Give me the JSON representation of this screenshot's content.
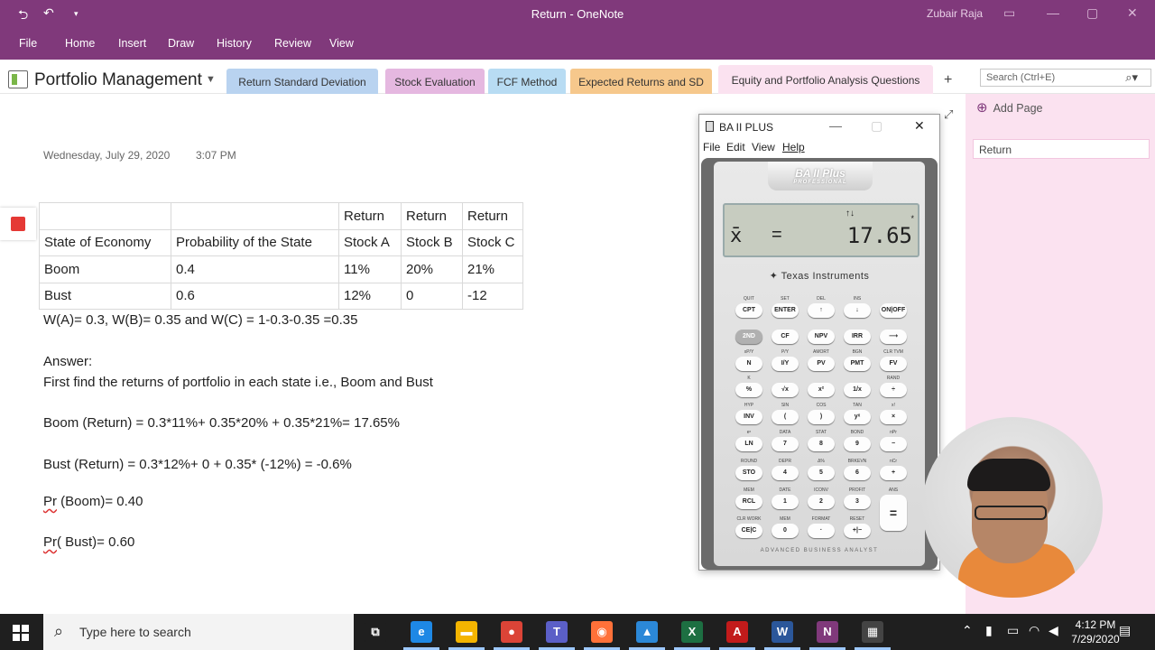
{
  "window": {
    "title": "Return - OneNote",
    "user": "Zubair Raja",
    "back_icon": "back-arrow-icon",
    "undo_icon": "undo-icon",
    "qat_icon": "customize-qat-icon"
  },
  "ribbon": {
    "menus": [
      "File",
      "Home",
      "Insert",
      "Draw",
      "History",
      "Review",
      "View"
    ]
  },
  "notebook": {
    "title": "Portfolio Management",
    "sections": [
      {
        "label": "Return Standard Deviation",
        "color": "#b9d3f0"
      },
      {
        "label": "Stock Evaluation",
        "color": "#e5b8e0"
      },
      {
        "label": "FCF Method",
        "color": "#b8dcf3"
      },
      {
        "label": "Expected Returns and SD",
        "color": "#f6c88c"
      },
      {
        "label": "Equity and Portfolio Analysis Questions",
        "color": "#fbe2f0"
      }
    ],
    "search_placeholder": "Search (Ctrl+E)"
  },
  "page": {
    "date": "Wednesday, July 29, 2020",
    "time": "3:07 PM",
    "table": [
      [
        "",
        "",
        "Return",
        "Return",
        "Return"
      ],
      [
        "State of Economy",
        "Probability of the State",
        "Stock A",
        "Stock B",
        "Stock C"
      ],
      [
        "Boom",
        "0.4",
        "11%",
        "20%",
        "21%"
      ],
      [
        "Bust",
        "0.6",
        "12%",
        "0",
        "-12"
      ]
    ],
    "weights": "W(A)= 0.3, W(B)= 0.35 and W(C) = 1-0.3-0.35 =0.35",
    "answer_label": "Answer:",
    "instruction": "First find the returns of portfolio in each state i.e., Boom and Bust",
    "boom_return": "Boom (Return) = 0.3*11%+ 0.35*20% + 0.35*21%= 17.65%",
    "bust_return": "Bust (Return) =  0.3*12%+ 0 + 0.35* (-12%) = -0.6%",
    "pr_boom_word": "Pr",
    "pr_boom_rest": " (Boom)= 0.40",
    "pr_bust_word": "Pr",
    "pr_bust_rest": "( Bust)= 0.60"
  },
  "pagelist": {
    "add_page": "Add Page",
    "pages": [
      "Return"
    ]
  },
  "calculator": {
    "title": "BA II PLUS",
    "menus": [
      "File",
      "Edit",
      "View",
      "Help"
    ],
    "brand": "BA II Plus",
    "brand_sub": "PROFESSIONAL",
    "display_symbol": "x̄",
    "display_eq": "=",
    "display_value": "17.65",
    "display_arrows": "↑↓",
    "display_star": "*",
    "maker": "Texas Instruments",
    "footer": "ADVANCED BUSINESS ANALYST",
    "keys": [
      [
        "CPT",
        "ENTER",
        "↑",
        "↓",
        "ON|OFF"
      ],
      [
        "2ND",
        "CF",
        "NPV",
        "IRR",
        "⟶"
      ],
      [
        "N",
        "I/Y",
        "PV",
        "PMT",
        "FV"
      ],
      [
        "%",
        "√x",
        "x²",
        "1/x",
        "÷"
      ],
      [
        "INV",
        "(",
        ")",
        "yˣ",
        "×"
      ],
      [
        "LN",
        "7",
        "8",
        "9",
        "−"
      ],
      [
        "STO",
        "4",
        "5",
        "6",
        "+"
      ],
      [
        "RCL",
        "1",
        "2",
        "3",
        "="
      ],
      [
        "CE|C",
        "0",
        "·",
        "+|−",
        ""
      ]
    ],
    "sublabels": [
      [
        "QUIT",
        "SET",
        "DEL",
        "INS",
        ""
      ],
      [
        "",
        "",
        "",
        "",
        ""
      ],
      [
        "xP/Y",
        "P/Y",
        "AMORT",
        "BGN",
        "CLR TVM"
      ],
      [
        "K",
        "",
        "",
        "",
        "RAND"
      ],
      [
        "HYP",
        "SIN",
        "COS",
        "TAN",
        "x!"
      ],
      [
        "eˣ",
        "DATA",
        "STAT",
        "BOND",
        "nPr"
      ],
      [
        "ROUND",
        "DEPR",
        "Δ%",
        "BRKEVN",
        "nCr"
      ],
      [
        "MEM",
        "DATE",
        "ICONV",
        "PROFIT",
        "ANS"
      ],
      [
        "CLR WORK",
        "MEM",
        "FORMAT",
        "RESET",
        ""
      ]
    ]
  },
  "taskbar": {
    "search_placeholder": "Type here to search",
    "time": "4:12 PM",
    "date": "7/29/2020",
    "apps": [
      {
        "icon": "task-view-icon",
        "color": "#1f1f1f",
        "glyph": "⧉"
      },
      {
        "icon": "edge-icon",
        "color": "#1e88e5",
        "glyph": "e"
      },
      {
        "icon": "file-explorer-icon",
        "color": "#f4b400",
        "glyph": "▬"
      },
      {
        "icon": "chrome-icon",
        "color": "#db4437",
        "glyph": "●"
      },
      {
        "icon": "teams-icon",
        "color": "#5b5fc7",
        "glyph": "T"
      },
      {
        "icon": "firefox-icon",
        "color": "#ff7139",
        "glyph": "◉"
      },
      {
        "icon": "photos-icon",
        "color": "#2b88d8",
        "glyph": "▲"
      },
      {
        "icon": "excel-icon",
        "color": "#1d6f42",
        "glyph": "X"
      },
      {
        "icon": "acrobat-icon",
        "color": "#c21b1b",
        "glyph": "A"
      },
      {
        "icon": "word-icon",
        "color": "#2b579a",
        "glyph": "W"
      },
      {
        "icon": "onenote-icon",
        "color": "#80397b",
        "glyph": "N"
      },
      {
        "icon": "calculator-icon",
        "color": "#444",
        "glyph": "▦"
      }
    ]
  }
}
